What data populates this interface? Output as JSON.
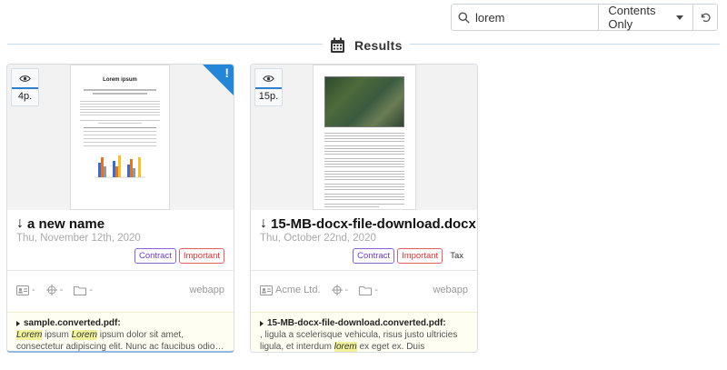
{
  "search": {
    "value": "lorem",
    "placeholder": "",
    "mode": "Contents Only"
  },
  "results": {
    "title": "Results"
  },
  "cards": [
    {
      "pages": "4p.",
      "title": "a new name",
      "date": "Thu, November 12th, 2020",
      "tags": [
        "Contract",
        "Important"
      ],
      "correspondent": "-",
      "storage": "-",
      "folder": "-",
      "source": "webapp",
      "snippet_file": "sample.converted.pdf:",
      "snippet_parts": [
        "",
        "Lorem",
        " ipsum ",
        "Lorem",
        " ipsum dolor sit amet, consectetur adipiscing elit. Nunc ac faucibus odio…"
      ],
      "thumb_doc_title": "Lorem ipsum",
      "flag": "!"
    },
    {
      "pages": "15p.",
      "title": "15-MB-docx-file-download.docx",
      "date": "Thu, October 22nd, 2020",
      "tags": [
        "Contract",
        "Important",
        "Tax"
      ],
      "correspondent": "Acme Ltd.",
      "storage": "-",
      "folder": "-",
      "source": "webapp",
      "snippet_file": "15-MB-docx-file-download.converted.pdf:",
      "snippet_parts": [
        ", ligula a scelerisque vehicula, risus justo ultricies ligula, et interdum ",
        "lorem",
        " ex eget ex. Duis dignissim…"
      ]
    }
  ],
  "colors": {
    "accent": "#2586d7",
    "contract": "#6b3cc4",
    "important": "#d33333",
    "highlight": "#f2f29a"
  }
}
